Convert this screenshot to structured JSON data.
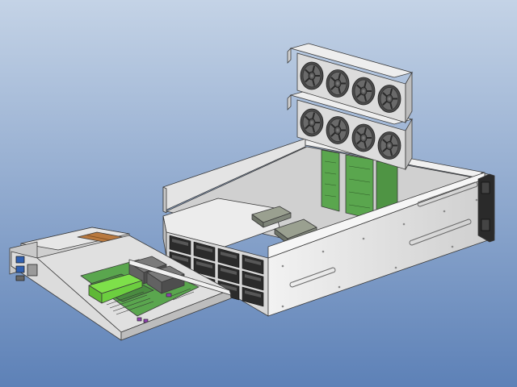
{
  "scene": {
    "background": {
      "top": "#c4d3e6",
      "bottom": "#5d81b7"
    },
    "colors": {
      "metal_light": "#ebebeb",
      "metal_mid": "#d6d6d6",
      "metal_dark": "#9c9c9c",
      "outline": "#3a3a3a",
      "pcb_green": "#5aa64e",
      "pcb_bright": "#7ee04a",
      "fan_gray": "#5a5a5a",
      "copper": "#b8793f",
      "handle_black": "#1e1e1e"
    },
    "parts": {
      "fan_modules": 2,
      "fans_per_module": 4,
      "drive_bays_visible": 12,
      "pcie_cards": 2
    }
  }
}
